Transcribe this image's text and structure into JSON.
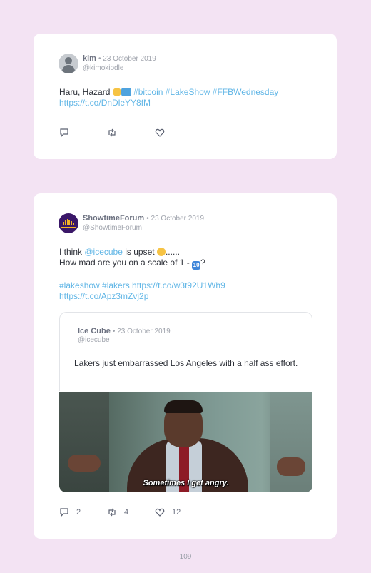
{
  "tweet1": {
    "name": "kim",
    "date": "• 23 October 2019",
    "handle": "@kimokiodle",
    "text_before": "Haru, Hazard ",
    "hashtags": "#bitcoin #LakeShow #FFBWednesday",
    "url": "https://t.co/DnDleYY8fM",
    "actions": {
      "reply_count": "",
      "retweet_count": "",
      "like_count": ""
    }
  },
  "tweet2": {
    "name": "ShowtimeForum",
    "date": "• 23 October 2019",
    "handle": "@ShowtimeForum",
    "line1_before": "I think ",
    "mention": "@icecube",
    "line1_after": " is upset ",
    "line1_end": "......",
    "line2_before": "How mad are you on a scale of 1 - ",
    "ten_emoji": "10",
    "line2_end": "?",
    "tags_line": "#lakeshow #lakers https://t.co/w3t92U1Wh9",
    "url2": "https://t.co/Apz3mZvj2p",
    "quote": {
      "name": "Ice Cube",
      "date": "• 23 October 2019",
      "handle": "@icecube",
      "text": "Lakers just embarrassed Los Angeles with a half ass effort."
    },
    "media_caption": "Sometimes I get angry.",
    "actions": {
      "reply_count": "2",
      "retweet_count": "4",
      "like_count": "12"
    }
  },
  "page_number": "109",
  "icons": [
    "reply-icon",
    "retweet-icon",
    "like-icon"
  ],
  "colors": {
    "background": "#f3e3f3",
    "link": "#61b6e6",
    "text": "#2d3038",
    "muted": "#a0a4ad"
  }
}
